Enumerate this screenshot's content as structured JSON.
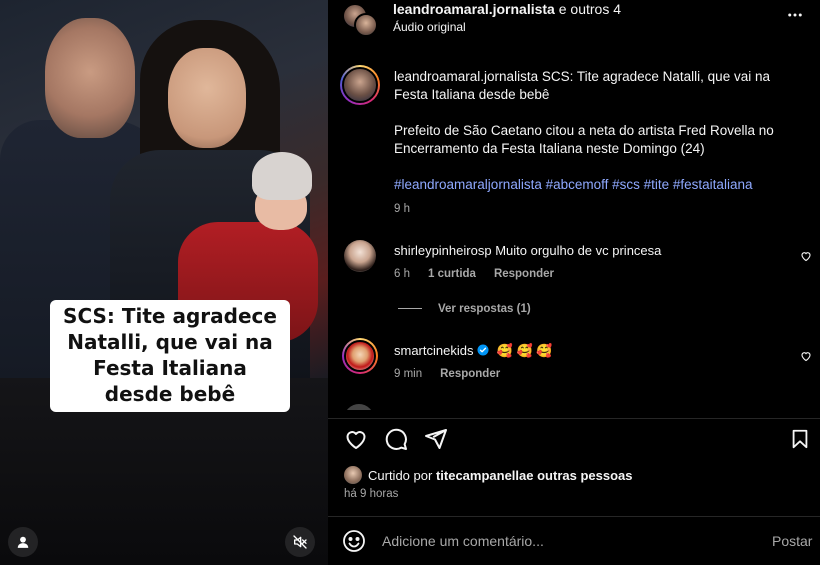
{
  "media": {
    "caption": "SCS: Tite agradece Natalli, que vai na Festa Italiana desde bebê"
  },
  "header": {
    "username": "leandroamaral.jornalista",
    "others": " e outros 4",
    "audio": "Áudio original",
    "more_icon": "more-horizontal-icon"
  },
  "post": {
    "username": "leandroamaral.jornalista",
    "title": "SCS: Tite agradece Natalli, que vai na Festa Italiana desde bebê",
    "body": "Prefeito de São Caetano citou a neta do artista Fred Rovella no Encerramento da Festa Italiana neste Domingo (24)",
    "hashtags": "#leandroamaraljornalista #abcemoff #scs #tite #festaitaliana",
    "time": "9 h"
  },
  "comments": [
    {
      "username": "shirleypinheirosp",
      "text": "Muito orgulho de vc princesa",
      "time": "6 h",
      "likes": "1 curtida",
      "reply": "Responder",
      "view_replies": "Ver respostas (1)"
    },
    {
      "username": "smartcinekids",
      "text": "🥰 🥰 🥰",
      "time": "9 min",
      "reply": "Responder"
    }
  ],
  "footer": {
    "liked_prefix": "Curtido por ",
    "liked_user": "titecampanella",
    "liked_suffix": " e outras pessoas",
    "time": "há 9 horas",
    "comment_placeholder": "Adicione um comentário...",
    "post_label": "Postar"
  },
  "colors": {
    "link": "#8fa9ff",
    "muted": "#a8a8a8",
    "verified": "#0095f6"
  }
}
